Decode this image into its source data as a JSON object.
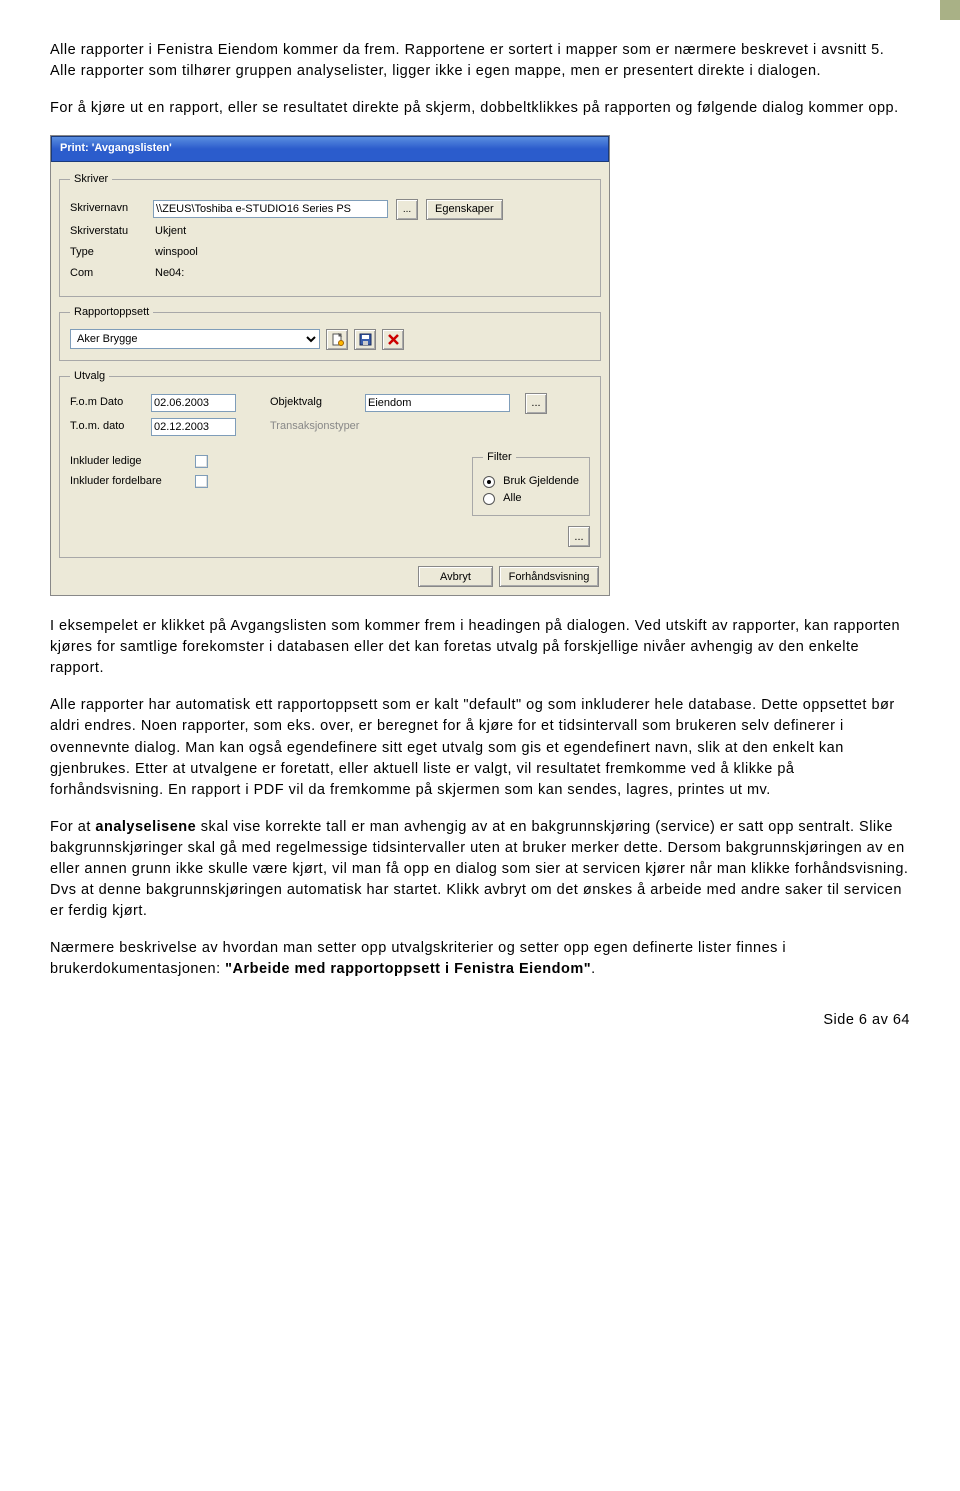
{
  "para1": "Alle rapporter i Fenistra Eiendom kommer da frem. Rapportene er sortert i mapper som er nærmere beskrevet i avsnitt 5. Alle rapporter som tilhører gruppen analyselister, ligger ikke i egen mappe, men er presentert direkte i dialogen.",
  "para2": "For å kjøre ut en rapport, eller se resultatet direkte på skjerm, dobbeltklikkes på rapporten og følgende dialog kommer opp.",
  "para3": "I eksempelet er klikket på Avgangslisten som kommer frem i headingen på dialogen. Ved utskift av rapporter, kan rapporten kjøres for samtlige forekomster i databasen eller det kan foretas utvalg på forskjellige nivåer avhengig av den enkelte rapport.",
  "para4": "Alle rapporter har automatisk ett rapportoppsett som er kalt \"default\" og som inkluderer hele database. Dette oppsettet bør aldri endres. Noen rapporter, som eks. over, er beregnet for å kjøre for et tidsintervall som brukeren selv definerer i ovennevnte dialog. Man kan også egendefinere sitt eget utvalg som gis et egendefinert navn, slik at den enkelt kan gjenbrukes. Etter at utvalgene er foretatt, eller aktuell liste er valgt, vil resultatet fremkomme ved å klikke på forhåndsvisning. En rapport i PDF vil da fremkomme på skjermen som kan sendes, lagres, printes ut mv.",
  "para5a": "For at ",
  "para5b": "analyselisene",
  "para5c": " skal vise korrekte tall er man avhengig av at en bakgrunnskjøring (service) er satt opp sentralt. Slike bakgrunnskjøringer skal gå med regelmessige tidsintervaller uten at bruker merker dette. Dersom bakgrunnskjøringen av en eller annen grunn ikke skulle være kjørt, vil man få opp en dialog som sier at servicen kjører når man klikke forhåndsvisning. Dvs at denne bakgrunnskjøringen automatisk har startet. Klikk avbryt om det ønskes å arbeide med andre saker til servicen er ferdig kjørt.",
  "para6a": "Nærmere beskrivelse av hvordan man setter opp utvalgskriterier og setter opp egen definerte lister finnes i brukerdokumentasjonen: ",
  "para6b": "\"Arbeide med rapportoppsett i Fenistra Eiendom\"",
  "para6c": ".",
  "footer": "Side 6 av 64",
  "dialog": {
    "title": "Print: 'Avgangslisten'",
    "skriver": {
      "legend": "Skriver",
      "lbl_name": "Skrivernavn",
      "val_name": "\\\\ZEUS\\Toshiba e-STUDIO16 Series PS",
      "lbl_status": "Skriverstatu",
      "val_status": "Ukjent",
      "lbl_type": "Type",
      "val_type": "winspool",
      "lbl_com": "Com",
      "val_com": "Ne04:",
      "btn_props": "Egenskaper",
      "btn_browse": "..."
    },
    "rapportoppsett": {
      "legend": "Rapportoppsett",
      "selected": "Aker Brygge"
    },
    "utvalg": {
      "legend": "Utvalg",
      "lbl_fom": "F.o.m Dato",
      "val_fom": "02.06.2003",
      "lbl_tom": "T.o.m. dato",
      "val_tom": "02.12.2003",
      "lbl_obj": "Objektvalg",
      "val_obj": "Eiendom",
      "lbl_trans": "Transaksjonstyper",
      "btn_browse": "...",
      "filter": {
        "legend": "Filter",
        "opt1": "Bruk Gjeldende",
        "opt2": "Alle"
      },
      "lbl_ledige": "Inkluder ledige",
      "lbl_fordel": "Inkluder fordelbare"
    },
    "buttons": {
      "cancel": "Avbryt",
      "preview": "Forhåndsvisning"
    }
  }
}
